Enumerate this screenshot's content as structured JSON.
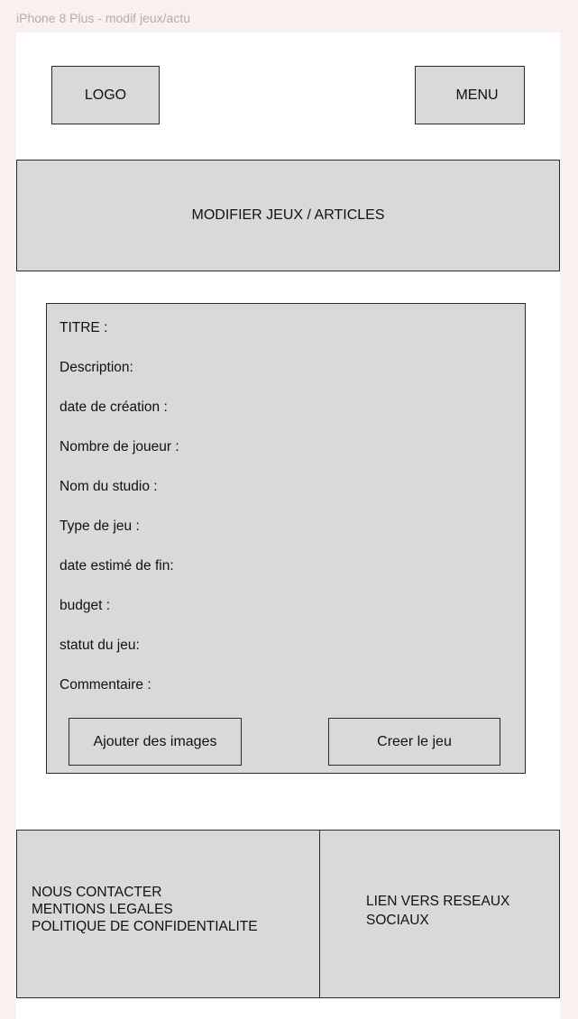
{
  "frame_label": "iPhone 8 Plus - modif jeux/actu",
  "header": {
    "logo": "LOGO",
    "menu": "MENU"
  },
  "banner": {
    "title": "MODIFIER JEUX / ARTICLES"
  },
  "form": {
    "fields": [
      "TITRE :",
      "Description:",
      "date de création :",
      "Nombre de joueur :",
      "Nom du studio :",
      "Type de jeu :",
      "date estimé de fin:",
      "budget :",
      "statut du jeu:",
      "Commentaire :"
    ],
    "add_images_label": "Ajouter des images",
    "create_label": "Creer le jeu"
  },
  "footer": {
    "links": [
      "NOUS CONTACTER",
      "MENTIONS LEGALES",
      "POLITIQUE DE CONFIDENTIALITE"
    ],
    "social": "LIEN VERS RESEAUX SOCIAUX"
  }
}
